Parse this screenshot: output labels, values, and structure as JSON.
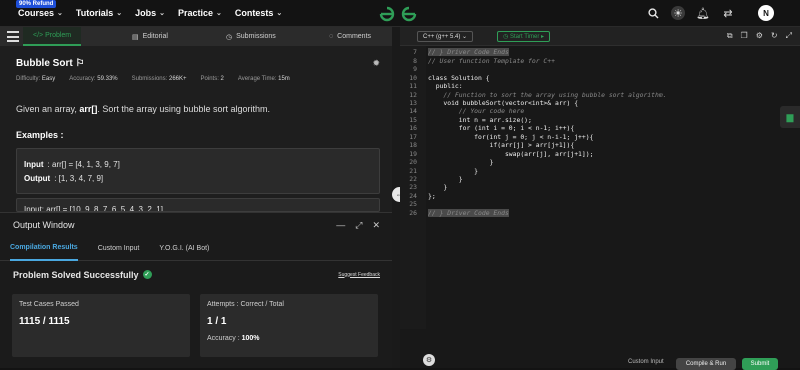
{
  "topbar": {
    "refund_badge": "90% Refund",
    "nav": [
      "Courses",
      "Tutorials",
      "Jobs",
      "Practice",
      "Contests"
    ],
    "avatar_initial": "N"
  },
  "tabs": {
    "problem": "</> Problem",
    "editorial": "Editorial",
    "submissions": "Submissions",
    "comments": "Comments"
  },
  "problem": {
    "title": "Bubble Sort",
    "difficulty_label": "Difficulty:",
    "difficulty": "Easy",
    "accuracy_label": "Accuracy:",
    "accuracy": "59.33%",
    "submissions_label": "Submissions:",
    "submissions": "266K+",
    "points_label": "Points:",
    "points": "2",
    "avg_time_label": "Average Time:",
    "avg_time": "15m",
    "desc_pre": "Given an array, ",
    "desc_bold": "arr[]",
    "desc_post": ". Sort the array using bubble sort algorithm.",
    "examples_heading": "Examples :",
    "example1": {
      "input_label": "Input",
      "input": ": arr[] = [4, 1, 3, 9, 7]",
      "output_label": "Output",
      "output": ": [1, 3, 4, 7, 9]"
    },
    "example2_partial": "Input: arr[] = [10, 9, 8, 7, 6, 5, 4, 3, 2, 1]"
  },
  "output_window": {
    "title": "Output Window",
    "tabs": [
      "Compilation Results",
      "Custom Input",
      "Y.O.G.I. (AI Bot)"
    ],
    "status": "Problem Solved Successfully",
    "suggest": "Suggest Feedback",
    "test_cases_label": "Test Cases Passed",
    "test_cases_value": "1115 / 1115",
    "attempts_label": "Attempts : Correct / Total",
    "attempts_value": "1 / 1",
    "accuracy_label": "Accuracy : ",
    "accuracy_value": "100%"
  },
  "editor": {
    "language": "C++ (g++ 5.4)",
    "timer": "Start Timer",
    "custom_input": "Custom Input",
    "compile_run": "Compile & Run",
    "submit": "Submit",
    "lines": [
      {
        "n": "7",
        "t": "// } Driver Code Ends"
      },
      {
        "n": "8",
        "t": "// User function Template for C++"
      },
      {
        "n": "9",
        "t": ""
      },
      {
        "n": "10",
        "t": "class Solution {"
      },
      {
        "n": "11",
        "t": "  public:"
      },
      {
        "n": "12",
        "t": "    // Function to sort the array using bubble sort algorithm."
      },
      {
        "n": "13",
        "t": "    void bubbleSort(vector<int>& arr) {"
      },
      {
        "n": "14",
        "t": "        // Your code here"
      },
      {
        "n": "15",
        "t": "        int n = arr.size();"
      },
      {
        "n": "16",
        "t": "        for (int i = 0; i < n-1; i++){"
      },
      {
        "n": "17",
        "t": "            for(int j = 0; j < n-i-1; j++){"
      },
      {
        "n": "18",
        "t": "                if(arr[j] > arr[j+1]){"
      },
      {
        "n": "19",
        "t": "                    swap(arr[j], arr[j+1]);"
      },
      {
        "n": "20",
        "t": "                }"
      },
      {
        "n": "21",
        "t": "            }"
      },
      {
        "n": "22",
        "t": "        }"
      },
      {
        "n": "23",
        "t": "    }"
      },
      {
        "n": "24",
        "t": "};"
      },
      {
        "n": "25",
        "t": ""
      },
      {
        "n": "26",
        "t": "// } Driver Code Ends"
      }
    ]
  },
  "colors": {
    "accent_green": "#2f9e57",
    "accent_blue": "#4aa8e0",
    "background": "#131313"
  }
}
